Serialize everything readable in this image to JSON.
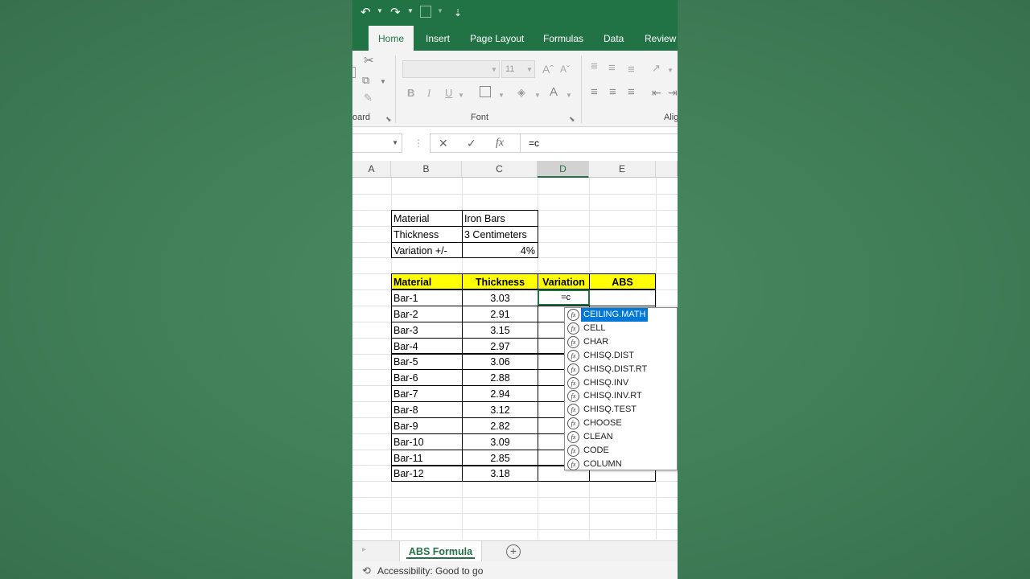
{
  "quick_access": {
    "undo": "↶",
    "redo": "↷",
    "more": "⇣"
  },
  "tabs": [
    "Home",
    "Insert",
    "Page Layout",
    "Formulas",
    "Data",
    "Review"
  ],
  "active_tab": "Home",
  "ribbon": {
    "font_size": "11",
    "clipboard_label": "oard",
    "font_label": "Font",
    "alignment_label": "Alig",
    "bold": "B",
    "italic": "I",
    "underline": "U",
    "font_color": "A"
  },
  "formula_bar": {
    "cancel": "✕",
    "enter": "✓",
    "fx": "fx",
    "value": "=c"
  },
  "columns": [
    "A",
    "B",
    "C",
    "D",
    "E"
  ],
  "selected_column": "D",
  "info_table": [
    {
      "label": "Material",
      "value": "Iron Bars"
    },
    {
      "label": "Thickness",
      "value": "3 Centimeters"
    },
    {
      "label": "Variation +/-",
      "value": "4%"
    }
  ],
  "data_table": {
    "headers": [
      "Material",
      "Thickness",
      "Variation",
      "ABS"
    ],
    "rows": [
      {
        "material": "Bar-1",
        "thickness": "3.03"
      },
      {
        "material": "Bar-2",
        "thickness": "2.91"
      },
      {
        "material": "Bar-3",
        "thickness": "3.15"
      },
      {
        "material": "Bar-4",
        "thickness": "2.97"
      },
      {
        "material": "Bar-5",
        "thickness": "3.06"
      },
      {
        "material": "Bar-6",
        "thickness": "2.88"
      },
      {
        "material": "Bar-7",
        "thickness": "2.94"
      },
      {
        "material": "Bar-8",
        "thickness": "3.12"
      },
      {
        "material": "Bar-9",
        "thickness": "2.82"
      },
      {
        "material": "Bar-10",
        "thickness": "3.09"
      },
      {
        "material": "Bar-11",
        "thickness": "2.85"
      },
      {
        "material": "Bar-12",
        "thickness": "3.18"
      }
    ],
    "editing_cell_value": "=c"
  },
  "autocomplete": {
    "items": [
      "CEILING.MATH",
      "CELL",
      "CHAR",
      "CHISQ.DIST",
      "CHISQ.DIST.RT",
      "CHISQ.INV",
      "CHISQ.INV.RT",
      "CHISQ.TEST",
      "CHOOSE",
      "CLEAN",
      "CODE",
      "COLUMN"
    ],
    "selected": "CEILING.MATH",
    "icon_text": "fx"
  },
  "sheet_tab": "ABS Formula",
  "add_sheet": "+",
  "status": "Accessibility: Good to go",
  "colors": {
    "excel_green": "#217346",
    "header_yellow": "#ffff00",
    "selection_blue": "#0078d7"
  }
}
